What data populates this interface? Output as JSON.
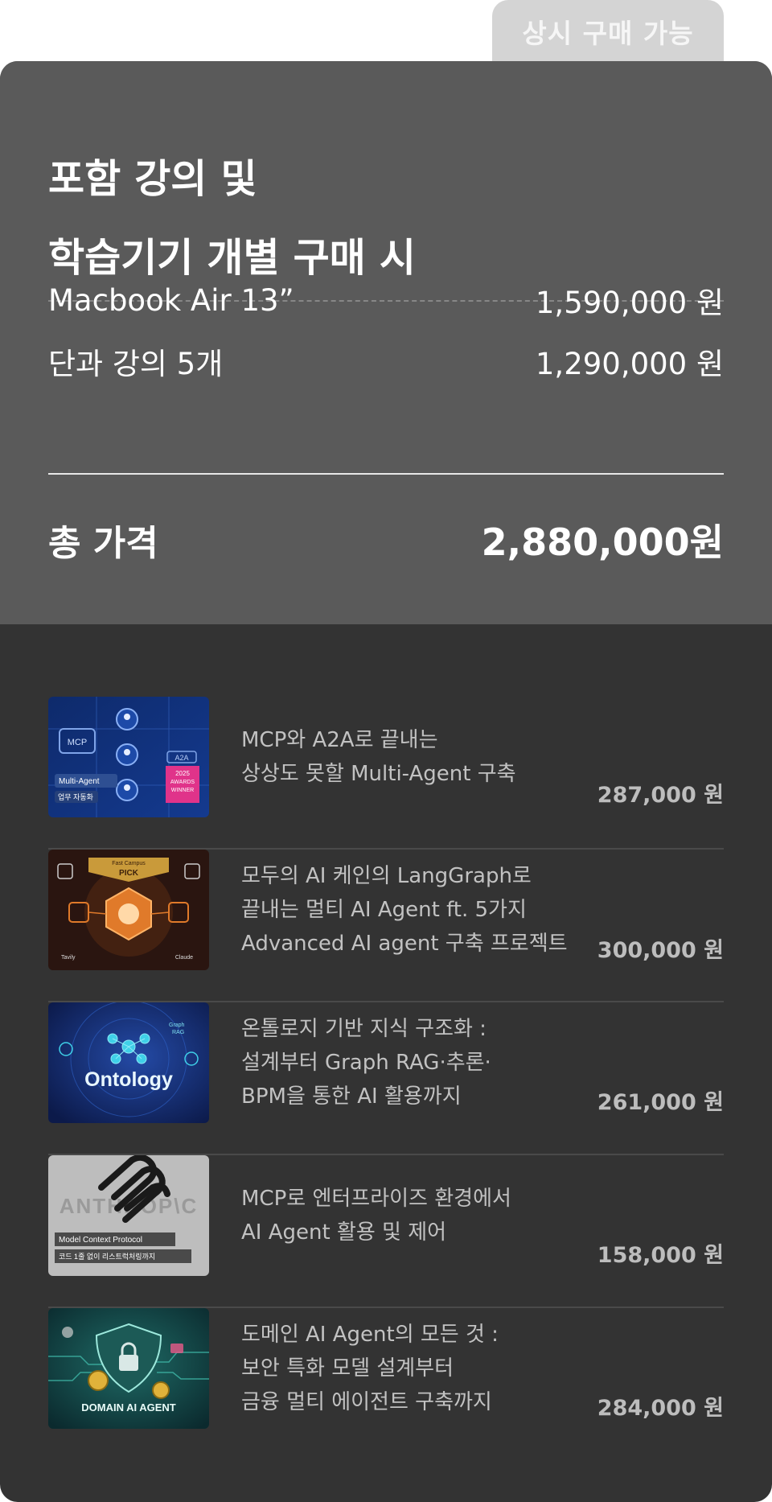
{
  "tab_label": "상시 구매 가능",
  "summary": {
    "title_line1": "포함 강의 및",
    "title_line2": "학습기기 개별 구매 시",
    "items": [
      {
        "label": "Macbook Air 13”",
        "price": "1,590,000 원"
      },
      {
        "label": "단과 강의 5개",
        "price": "1,290,000 원"
      }
    ],
    "total_label": "총 가격",
    "total_value": "2,880,000원"
  },
  "courses": [
    {
      "line1": "MCP와 A2A로 끝내는",
      "line2": "상상도 못할 Multi-Agent 구축",
      "line3": "",
      "price": "287,000 원",
      "thumb": {
        "label1": "MCP",
        "label2": "Multi-Agent",
        "label3": "업무 자동화",
        "badge1": "A2A",
        "badge2": "2025",
        "badge3": "AWARDS",
        "badge4": "WINNER"
      }
    },
    {
      "line1": "모두의 AI 케인의 LangGraph로",
      "line2": "끝내는 멀티 AI Agent ft. 5가지",
      "line3": "Advanced AI agent 구축 프로젝트",
      "price": "300,000 원",
      "thumb": {
        "label1": "Fast Campus",
        "label2": "PICK",
        "label3": "Tavily",
        "label4": "Claude"
      }
    },
    {
      "line1": "온톨로지 기반 지식 구조화 :",
      "line2": "설계부터 Graph RAG·추론·",
      "line3": "BPM을 통한 AI 활용까지",
      "price": "261,000 원",
      "thumb": {
        "label1": "Ontology",
        "label2": "Graph",
        "label3": "RAG"
      }
    },
    {
      "line1": "MCP로 엔터프라이즈 환경에서",
      "line2": "AI Agent 활용 및 제어",
      "line3": "",
      "price": "158,000 원",
      "thumb": {
        "label1": "ANTHROP\\C",
        "label2": "Model Context Protocol",
        "label3": "코드 1줄 없이 리스트럭처링까지"
      }
    },
    {
      "line1": "도메인 AI Agent의 모든 것 :",
      "line2": "보안 특화 모델 설계부터",
      "line3": "금융 멀티 에이전트 구축까지",
      "price": "284,000 원",
      "thumb": {
        "label1": "DOMAIN AI AGENT"
      }
    }
  ]
}
